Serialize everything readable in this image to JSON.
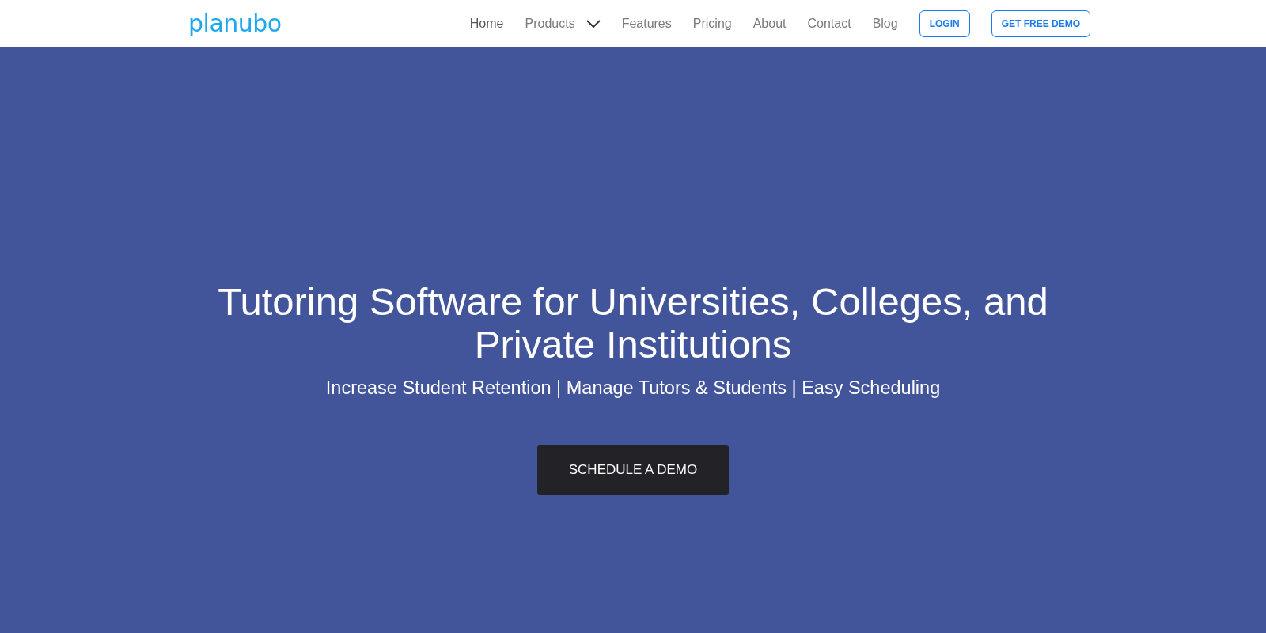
{
  "logo": "planubo",
  "nav": [
    {
      "label": "Home",
      "selected": true,
      "dropdown": false
    },
    {
      "label": "Products",
      "selected": false,
      "dropdown": true
    },
    {
      "label": "Features",
      "selected": false,
      "dropdown": false
    },
    {
      "label": "Pricing",
      "selected": false,
      "dropdown": false
    },
    {
      "label": "About",
      "selected": false,
      "dropdown": false
    },
    {
      "label": "Contact",
      "selected": false,
      "dropdown": false
    },
    {
      "label": "Blog",
      "selected": false,
      "dropdown": false
    }
  ],
  "nav_buttons": [
    "LOGIN",
    "GET FREE DEMO"
  ],
  "hero": {
    "title": "Tutoring Software for Universities, Colleges, and Private Institutions",
    "subtitle": "Increase Student Retention | Manage Tutors & Students | Easy Scheduling",
    "button": "SCHEDULE A DEMO"
  }
}
